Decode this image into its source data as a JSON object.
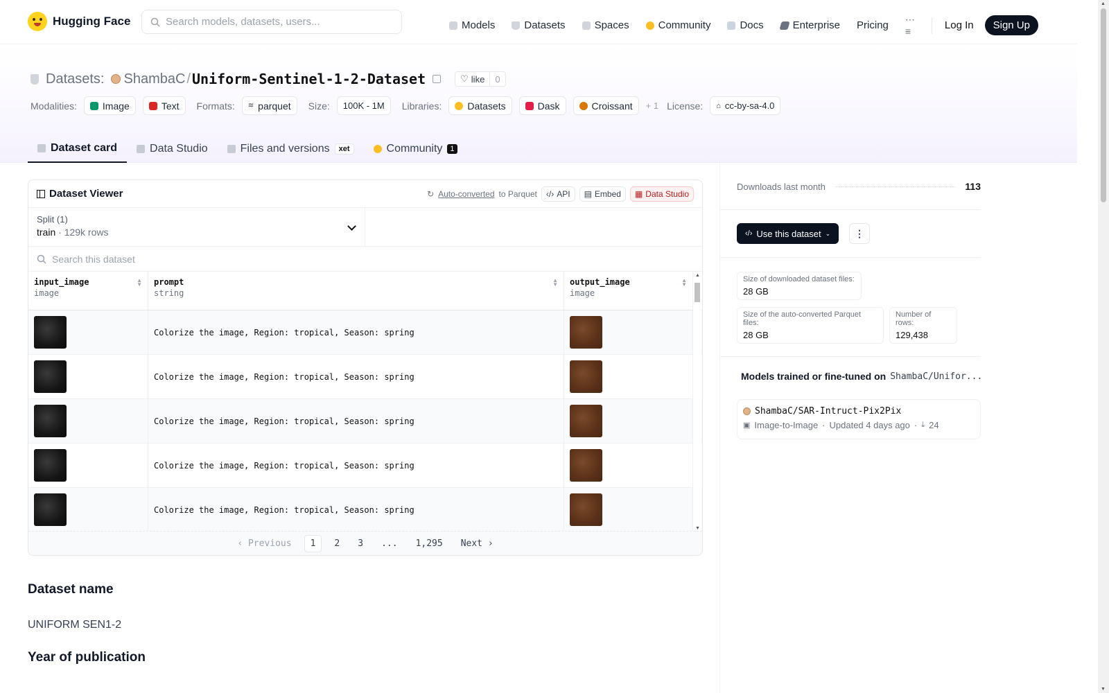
{
  "nav": {
    "brand": "Hugging Face",
    "search_placeholder": "Search models, datasets, users...",
    "links": [
      "Models",
      "Datasets",
      "Spaces",
      "Community",
      "Docs",
      "Enterprise",
      "Pricing"
    ],
    "login": "Log In",
    "signup": "Sign Up"
  },
  "header": {
    "section": "Datasets:",
    "owner": "ShambaC",
    "slash": "/",
    "repo": "Uniform-Sentinel-1-2-Dataset",
    "like_label": "like",
    "like_count": "0",
    "modalities_label": "Modalities:",
    "modalities": [
      "Image",
      "Text"
    ],
    "formats_label": "Formats:",
    "format": "parquet",
    "size_label": "Size:",
    "size": "100K - 1M",
    "libraries_label": "Libraries:",
    "libraries": [
      "Datasets",
      "Dask",
      "Croissant"
    ],
    "libraries_more": "+ 1",
    "license_label": "License:",
    "license": "cc-by-sa-4.0"
  },
  "tabs": {
    "card": "Dataset card",
    "studio": "Data Studio",
    "files": "Files and versions",
    "files_badge": "xet",
    "community": "Community",
    "community_count": "1"
  },
  "viewer": {
    "title": "Dataset Viewer",
    "auto_converted": "Auto-converted",
    "to_parquet": "to Parquet",
    "api": "API",
    "embed": "Embed",
    "studio": "Data Studio",
    "split_label": "Split (1)",
    "split_value": "train",
    "split_rows": "129k rows",
    "search_placeholder": "Search this dataset",
    "columns": [
      {
        "name": "input_image",
        "type": "image"
      },
      {
        "name": "prompt",
        "type": "string"
      },
      {
        "name": "output_image",
        "type": "image"
      }
    ],
    "rows": [
      {
        "prompt": "Colorize the image, Region: tropical, Season: spring"
      },
      {
        "prompt": "Colorize the image, Region: tropical, Season: spring"
      },
      {
        "prompt": "Colorize the image, Region: tropical, Season: spring"
      },
      {
        "prompt": "Colorize the image, Region: tropical, Season: spring"
      },
      {
        "prompt": "Colorize the image, Region: tropical, Season: spring"
      }
    ],
    "pager": {
      "previous": "Previous",
      "pages": [
        "1",
        "2",
        "3",
        "...",
        "1,295"
      ],
      "next": "Next"
    }
  },
  "card": {
    "h_name": "Dataset name",
    "name": "UNIFORM SEN1-2",
    "h_year": "Year of publication"
  },
  "sidebar": {
    "downloads_label": "Downloads last month",
    "downloads": "113",
    "use_button": "Use this dataset",
    "size_dl_label": "Size of downloaded dataset files:",
    "size_dl": "28 GB",
    "size_parquet_label": "Size of the auto-converted Parquet files:",
    "size_parquet": "28 GB",
    "rows_label": "Number of rows:",
    "rows": "129,438",
    "models_heading": "Models trained or fine-tuned on",
    "models_repo": "ShambaC/Unifor...",
    "model": {
      "name": "ShambaC/SAR-Intruct-Pix2Pix",
      "task": "Image-to-Image",
      "updated": "Updated 4 days ago",
      "downloads": "24"
    }
  }
}
